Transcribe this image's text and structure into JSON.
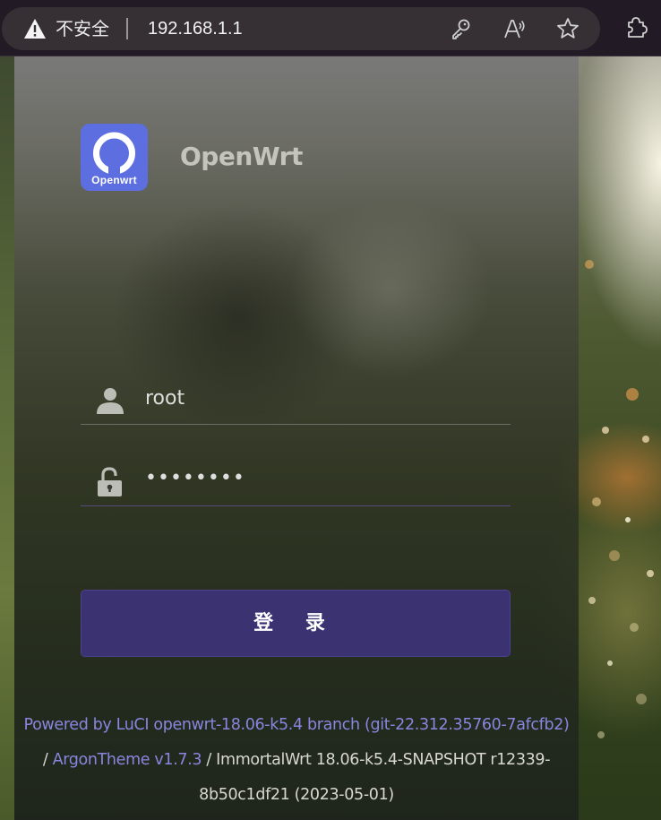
{
  "browser": {
    "insecure_label": "不安全",
    "url": "192.168.1.1",
    "icons": [
      "warning-icon",
      "key-icon",
      "read-aloud-icon",
      "favorite-star-icon",
      "extensions-icon"
    ]
  },
  "brand": {
    "logo_text": "Openwrt",
    "name": "OpenWrt",
    "logo_color": "#5c6ee0"
  },
  "login": {
    "username_value": "root",
    "password_value": "••••••••",
    "submit_label": "登 录",
    "button_color": "#3b3272"
  },
  "footer": {
    "powered_by_link": "Powered by LuCI openwrt-18.06-k5.4 branch (git-22.312.35760-7afcfb2)",
    "separator1": "/",
    "theme_link": "ArgonTheme v1.7.3",
    "build_info": "/ ImmortalWrt 18.06-k5.4-SNAPSHOT r12339-8b50c1df21 (2023-05-01)",
    "link_color": "#8a85de"
  }
}
